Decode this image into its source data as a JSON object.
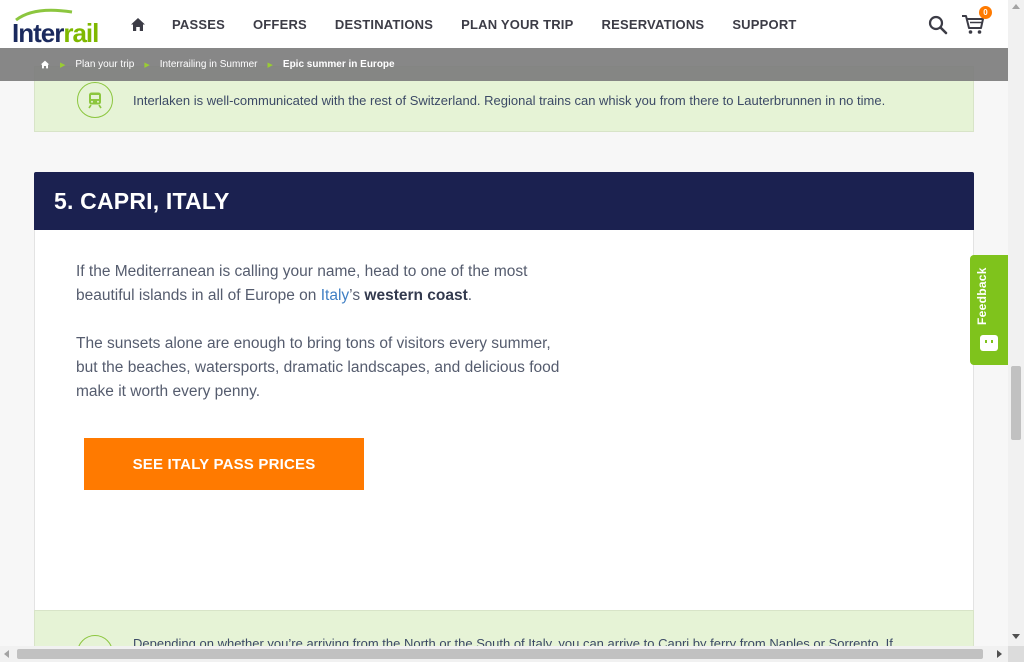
{
  "logo": {
    "part1": "Inter",
    "part2": "rail"
  },
  "nav": {
    "items": [
      "PASSES",
      "OFFERS",
      "DESTINATIONS",
      "PLAN YOUR TRIP",
      "RESERVATIONS",
      "SUPPORT"
    ]
  },
  "cart": {
    "count": "0"
  },
  "breadcrumb": {
    "items": [
      "Plan your trip",
      "Interrailing in Summer",
      "Epic summer in Europe"
    ]
  },
  "tip_top": {
    "text": "Interlaken is well-communicated with the rest of Switzerland. Regional trains can whisk you from there to Lauterbrunnen in no time."
  },
  "section": {
    "title": "5. CAPRI, ITALY",
    "p1_before": "If the Mediterranean is calling your name, head to one of the most beautiful islands in all of Europe on ",
    "p1_link": "Italy",
    "p1_mid": "’s ",
    "p1_bold": "western coast",
    "p1_end": ".",
    "p2": "The sunsets alone are enough to bring tons of visitors every summer, but the beaches, watersports, dramatic landscapes, and delicious food make it worth every penny.",
    "cta_label": "SEE ITALY PASS PRICES"
  },
  "tip_bottom": {
    "text": "Depending on whether you’re arriving from the North or the South of Italy, you can arrive to Capri by ferry from Naples or Sorrento. If"
  },
  "feedback": {
    "label": "Feedback"
  },
  "colors": {
    "navy": "#1b2150",
    "orange": "#ff7a00",
    "green": "#7fc31c",
    "tip_bg": "#e6f3d6",
    "link": "#3f7fc4"
  }
}
